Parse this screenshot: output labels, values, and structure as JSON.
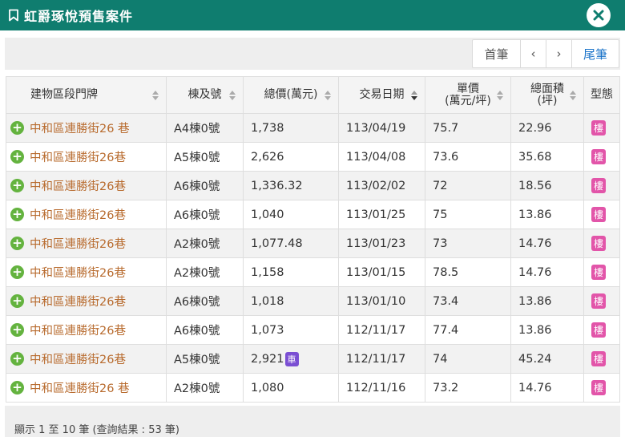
{
  "window": {
    "title": "虹爵琢悅預售案件",
    "title_icon": "bookmark-icon",
    "close_icon": "close-icon"
  },
  "pager": {
    "first": "首筆",
    "prev": "‹",
    "next": "›",
    "last": "尾筆"
  },
  "columns": [
    "建物區段門牌",
    "棟及號",
    "總價(萬元)",
    "交易日期",
    "單價\n(萬元/坪)",
    "總面積\n(坪)",
    "型態"
  ],
  "rows": [
    {
      "address": "中和區連勝街26 巷",
      "unit": "A4棟0號",
      "price": "1,738",
      "date": "113/04/19",
      "unit_price": "75.7",
      "area": "22.96",
      "type": "樓",
      "car": ""
    },
    {
      "address": "中和區連勝街26巷",
      "unit": "A5棟0號",
      "price": "2,626",
      "date": "113/04/08",
      "unit_price": "73.6",
      "area": "35.68",
      "type": "樓",
      "car": ""
    },
    {
      "address": "中和區連勝街26巷",
      "unit": "A6棟0號",
      "price": "1,336.32",
      "date": "113/02/02",
      "unit_price": "72",
      "area": "18.56",
      "type": "樓",
      "car": ""
    },
    {
      "address": "中和區連勝街26巷",
      "unit": "A6棟0號",
      "price": "1,040",
      "date": "113/01/25",
      "unit_price": "75",
      "area": "13.86",
      "type": "樓",
      "car": ""
    },
    {
      "address": "中和區連勝街26巷",
      "unit": "A2棟0號",
      "price": "1,077.48",
      "date": "113/01/23",
      "unit_price": "73",
      "area": "14.76",
      "type": "樓",
      "car": ""
    },
    {
      "address": "中和區連勝街26巷",
      "unit": "A2棟0號",
      "price": "1,158",
      "date": "113/01/15",
      "unit_price": "78.5",
      "area": "14.76",
      "type": "樓",
      "car": ""
    },
    {
      "address": "中和區連勝街26巷",
      "unit": "A6棟0號",
      "price": "1,018",
      "date": "113/01/10",
      "unit_price": "73.4",
      "area": "13.86",
      "type": "樓",
      "car": ""
    },
    {
      "address": "中和區連勝街26巷",
      "unit": "A6棟0號",
      "price": "1,073",
      "date": "112/11/17",
      "unit_price": "77.4",
      "area": "13.86",
      "type": "樓",
      "car": ""
    },
    {
      "address": "中和區連勝街26巷",
      "unit": "A5棟0號",
      "price": "2,921",
      "date": "112/11/17",
      "unit_price": "74",
      "area": "45.24",
      "type": "樓",
      "car": "車"
    },
    {
      "address": "中和區連勝街26 巷",
      "unit": "A2棟0號",
      "price": "1,080",
      "date": "112/11/16",
      "unit_price": "73.2",
      "area": "14.76",
      "type": "樓",
      "car": ""
    }
  ],
  "footer": {
    "summary": "顯示 1 至 10 筆 (查詢結果 : 53 筆)"
  },
  "colors": {
    "titlebar": "#0f7d6f",
    "address": "#b86b2e",
    "plus": "#64b33f",
    "type_badge": "#e255a9",
    "car_badge": "#7b4fd3",
    "pager_last": "#1a73c9"
  },
  "icons": {
    "expand": "plus-circle-icon",
    "sort": "sort-arrows-icon",
    "sort_active": "sort-desc-icon"
  }
}
